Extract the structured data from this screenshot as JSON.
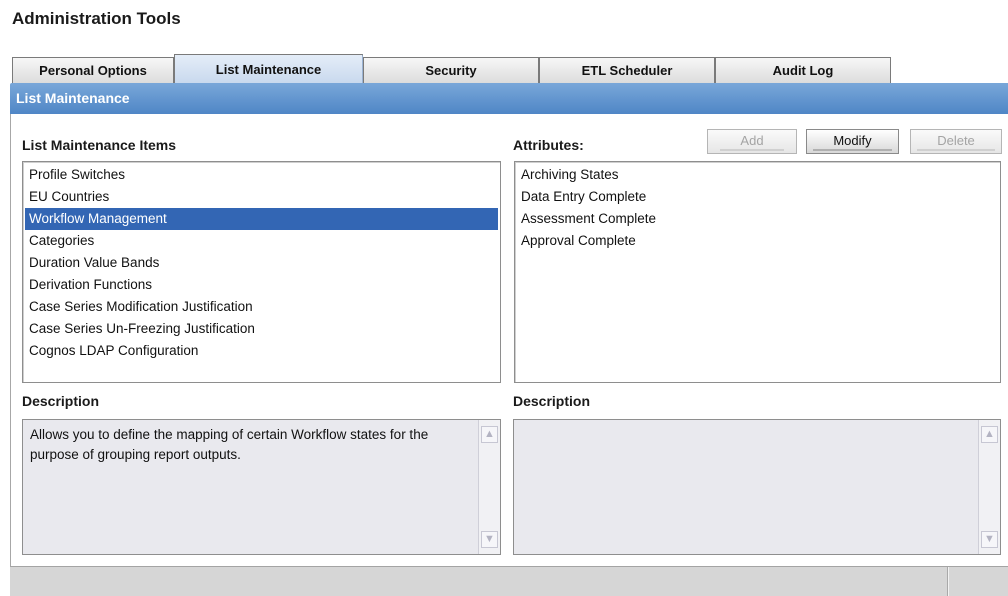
{
  "app": {
    "title": "Administration Tools"
  },
  "tabs": [
    {
      "label": "Personal Options"
    },
    {
      "label": "List Maintenance"
    },
    {
      "label": "Security"
    },
    {
      "label": "ETL Scheduler"
    },
    {
      "label": "Audit Log"
    }
  ],
  "active_tab": "List Maintenance",
  "panel": {
    "title": "List Maintenance"
  },
  "items_section": {
    "label": "List Maintenance Items",
    "items": [
      "Profile Switches",
      "EU Countries",
      "Workflow Management",
      "Categories",
      "Duration Value Bands",
      "Derivation Functions",
      "Case Series Modification Justification",
      "Case Series Un-Freezing Justification",
      "Cognos LDAP Configuration"
    ],
    "selected": "Workflow Management"
  },
  "attributes_section": {
    "label": "Attributes:",
    "items": [
      "Archiving States",
      "Data Entry Complete",
      "Assessment Complete",
      "Approval Complete"
    ],
    "buttons": {
      "add": "Add",
      "modify": "Modify",
      "delete": "Delete"
    }
  },
  "left_description": {
    "label": "Description",
    "text": "Allows you to define the mapping of certain Workflow states for the purpose of grouping report outputs."
  },
  "right_description": {
    "label": "Description",
    "text": ""
  },
  "icons": {
    "scroll_up": "chevron-up-icon",
    "scroll_down": "chevron-down-icon"
  },
  "colors": {
    "panel_header": "#5a8fcc",
    "selected_row": "#3366b4",
    "description_bg": "#e9e9ee"
  }
}
